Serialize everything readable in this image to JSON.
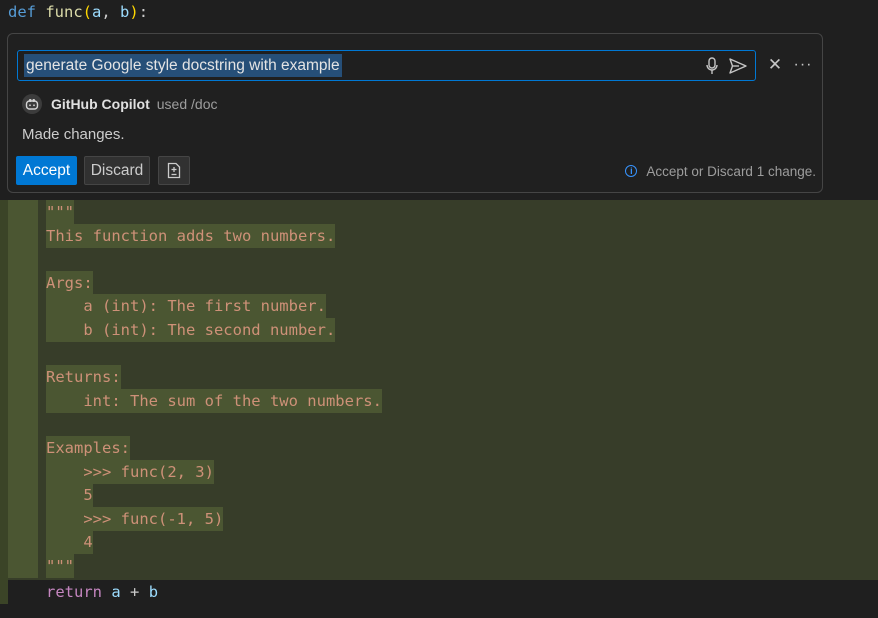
{
  "editor": {
    "signature": {
      "keyword": "def",
      "name": "func",
      "open": "(",
      "param_a": "a",
      "comma": ", ",
      "param_b": "b",
      "close": ")",
      "colon": ":"
    }
  },
  "inline_chat": {
    "prompt_text": "generate Google style docstring with example",
    "agent_name": "GitHub Copilot",
    "agent_used": "used /doc",
    "status": "Made changes.",
    "accept_label": "Accept",
    "discard_label": "Discard",
    "hint": "Accept or Discard 1 change."
  },
  "docstring_lines": [
    "\"\"\"",
    "This function adds two numbers.",
    "",
    "Args:",
    "    a (int): The first number.",
    "    b (int): The second number.",
    "",
    "Returns:",
    "    int: The sum of the two numbers.",
    "",
    "Examples:",
    "    >>> func(2, 3)",
    "    5",
    "    >>> func(-1, 5)",
    "    4",
    "\"\"\""
  ],
  "return_line": {
    "keyword": "return",
    "a": "a",
    "op": " + ",
    "b": "b"
  },
  "colors": {
    "accent": "#0078d4",
    "string": "#ce9178",
    "inserted_bg": "#373d29"
  }
}
